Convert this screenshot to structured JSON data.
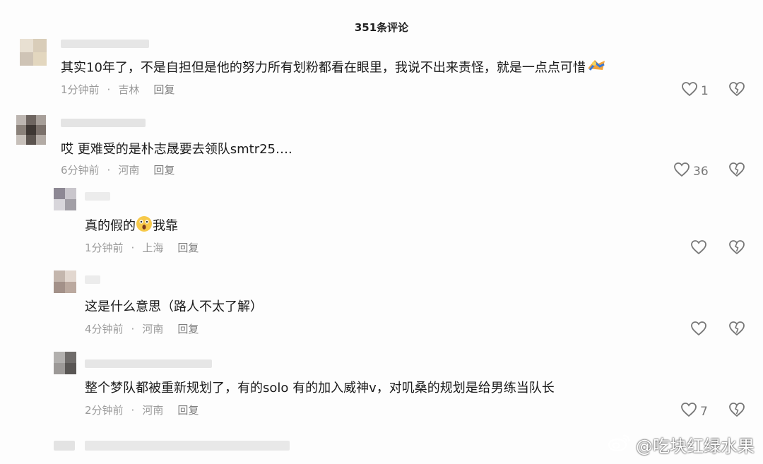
{
  "header": {
    "title": "351条评论"
  },
  "comments": [
    {
      "text": "其实10年了，不是自担但是他的努力所有划粉都看在眼里，我说不出来责怪，就是一点点可惜",
      "time": "1分钟前",
      "location": "吉林",
      "reply": "回复",
      "likes": "1"
    },
    {
      "text": "哎 更难受的是朴志晟要去领队smtr25…. ",
      "time": "6分钟前",
      "location": "河南",
      "reply": "回复",
      "likes": "36"
    },
    {
      "text_before": "真的假的",
      "text_after": "我靠",
      "time": "1分钟前",
      "location": "上海",
      "reply": "回复",
      "likes": ""
    },
    {
      "text": "这是什么意思（路人不太了解）",
      "time": "4分钟前",
      "location": "河南",
      "reply": "回复",
      "likes": ""
    },
    {
      "text": "整个梦队都被重新规划了，有的solo 有的加入威神v，对叽桑的规划是给男练当队长",
      "time": "2分钟前",
      "location": "河南",
      "reply": "回复",
      "likes": "7"
    }
  ],
  "icons": {
    "like": "heart-outline-icon",
    "dislike": "broken-heart-icon",
    "emoji_1": "cheering-emoji-icon",
    "emoji_2": "shocked-emoji-icon",
    "watermark": "weibo-logo-icon"
  },
  "watermark": {
    "text": "@吃块红绿水果"
  },
  "colors": {
    "text": "#1a1a1a",
    "meta": "#9a9a9a",
    "icon": "#777777"
  }
}
